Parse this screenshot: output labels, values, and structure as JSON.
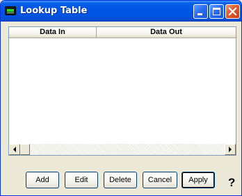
{
  "window": {
    "title": "Lookup Table"
  },
  "table": {
    "columns": [
      "Data In",
      "Data Out"
    ],
    "rows": []
  },
  "buttons": {
    "add": "Add",
    "edit": "Edit",
    "delete": "Delete",
    "cancel": "Cancel",
    "apply": "Apply"
  },
  "help": "?",
  "icons": {
    "app": "lookup-table-app-icon",
    "minimize": "minimize-icon",
    "maximize": "maximize-icon",
    "close": "close-icon",
    "scroll_left": "arrow-left-icon",
    "scroll_right": "arrow-right-icon"
  },
  "colors": {
    "titlebar": "#0054e3",
    "close_button": "#e05a2a",
    "window_bg": "#ece9d8"
  }
}
